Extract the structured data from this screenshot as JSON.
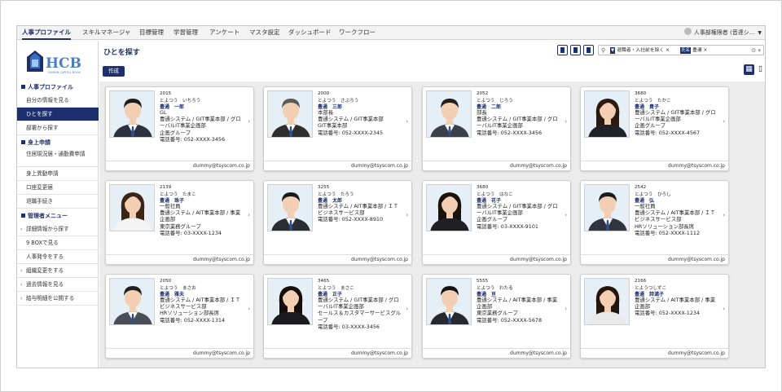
{
  "nav": {
    "items": [
      "人事プロファイル",
      "スキルマネージャ",
      "目標管理",
      "学習管理",
      "アンケート",
      "マスタ設定",
      "ダッシュボード",
      "ワークフロー"
    ],
    "active_index": 0,
    "user_label": "人事部権限者 (音達シ..."
  },
  "sidebar": {
    "logo_text": "HCB",
    "sections": [
      {
        "title": "人事プロファイル",
        "items": [
          "自分の情報を見る",
          "ひとを探す",
          "部署から探す"
        ],
        "active": 1
      },
      {
        "title": "身上申請",
        "items": [
          "住居現況届・通勤費申請",
          "身上異動申請",
          "口座変更届",
          "退職手続き"
        ]
      },
      {
        "title": "管理者メニュー",
        "items": [
          "詳細情報から探す",
          "9 BOXで見る",
          "人事発令をする",
          "組織変更をする",
          "過去情報を見る",
          "給与明細を公開する"
        ]
      }
    ]
  },
  "main": {
    "title": "ひとを探す",
    "create_label": "作成",
    "filter": {
      "tag1": "退職者・入社前を除く",
      "tag1_icon": "▼",
      "tag2": "豊達",
      "tag2_icon": "氏名"
    }
  },
  "colors": {
    "brand": "#1d2f6e",
    "grid_bg": "#ececec"
  },
  "cards": [
    {
      "code": "2015",
      "kana": "とよつう　いちろう",
      "name": "豊通　一郎",
      "lines": [
        "GL",
        "豊通システム / GIT事業本部 / グロ",
        "ーバルIT事業企画部",
        "企画グループ",
        "電話番号: 052-XXXX-3456"
      ],
      "email": "dummy@tsyscom.co.jp",
      "gender": "m",
      "suit": "#2b3140",
      "hair": "#1c1c1c"
    },
    {
      "code": "2000",
      "kana": "とよつう　さぶろう",
      "name": "豊通　三郎",
      "lines": [
        "本部長",
        "豊通システム / GIT事業本部",
        "GIT事業本部",
        "電話番号: 052-XXXX-2345"
      ],
      "email": "dummy@tsyscom.co.jp",
      "gender": "m",
      "suit": "#2e2e2e",
      "hair": "#5a5a5a"
    },
    {
      "code": "2052",
      "kana": "とよつう　じろう",
      "name": "豊通　二郎",
      "lines": [
        "部長",
        "豊通システム / GIT事業本部 / グロ",
        "ーバルIT事業企画部",
        "電話番号: 052-XXXX-3456"
      ],
      "email": "dummy@tsyscom.co.jp",
      "gender": "m",
      "suit": "#3a3f4b",
      "hair": "#202020"
    },
    {
      "code": "3680",
      "kana": "とよつう　たかこ",
      "name": "豊通　貴子",
      "lines": [
        "豊通システム / GIT事業本部 / グロ",
        "ーバルIT事業企画部",
        "企画グループ",
        "電話番号: 052-XXXX-4567"
      ],
      "email": "dummy@tsyscom.co.jp",
      "gender": "f",
      "suit": "#1f2228",
      "hair": "#2a1a12"
    },
    {
      "code": "2139",
      "kana": "とよつう　たまこ",
      "name": "豊通　珠子",
      "lines": [
        "一般社員",
        "豊通システム / AIT事業本部 / 事業",
        "企画部",
        "東京業務グループ",
        "電話番号: 03-XXXX-1234"
      ],
      "email": "dummy@tsyscom.co.jp",
      "gender": "f",
      "suit": "#f4f4f4",
      "hair": "#3a2416"
    },
    {
      "code": "3255",
      "kana": "とよつう　たろう",
      "name": "豊通　太郎",
      "lines": [
        "豊通システム / AIT事業本部 / ＩＴ",
        "ビジネスサービス部",
        "電話番号: 052-XXXX-8910"
      ],
      "email": "dummy@tsyscom.co.jp",
      "gender": "m",
      "suit": "#2a2d33",
      "hair": "#1a1a1a"
    },
    {
      "code": "3680",
      "kana": "とよつう　はなこ",
      "name": "豊通　花子",
      "lines": [
        "豊通システム / GIT事業本部 / グロ",
        "ーバルIT事業企画部",
        "企画グループ",
        "電話番号: 03-XXXX-9101"
      ],
      "email": "dummy@tsyscom.co.jp",
      "gender": "f",
      "suit": "#1f1f24",
      "hair": "#1b120c"
    },
    {
      "code": "2542",
      "kana": "とよつう　ひろし",
      "name": "豊通　弘",
      "lines": [
        "一般社員",
        "豊通システム / AIT事業本部 / ＩＴ",
        "ビジネスサービス部",
        "HRソリューション部長席",
        "電話番号: 052-XXXX-1112"
      ],
      "email": "dummy@tsyscom.co.jp",
      "gender": "m",
      "suit": "#30343c",
      "hair": "#1c1c1c"
    },
    {
      "code": "2050",
      "kana": "とよつう　まさお",
      "name": "豊通　雅夫",
      "lines": [
        "豊通システム / AIT事業本部 / ＩＴ",
        "ビジネスサービス部",
        "HRソリューション部長席",
        "電話番号: 052-XXXX-1314"
      ],
      "email": "dummy@tsyscom.co.jp",
      "gender": "m",
      "suit": "#4a4e57",
      "hair": "#1f1f1f"
    },
    {
      "code": "3465",
      "kana": "とよつう　まさこ",
      "name": "豊通　正子",
      "lines": [
        "豊通システム / GIT事業本部 / グロ",
        "ーバルIT事業企画部",
        "セールス＆カスタマーサービスグル",
        "ープ",
        "電話番号: 03-XXXX-3456"
      ],
      "email": "dummy@tsyscom.co.jp",
      "gender": "f",
      "suit": "#1c1c20",
      "hair": "#150e0a"
    },
    {
      "code": "5555",
      "kana": "とよつう　わたる",
      "name": "豊通　亘",
      "lines": [
        "豊通システム / AIT事業本部 / 事業",
        "企画部",
        "東京業務グループ",
        "電話番号: 052-XXXX-5678"
      ],
      "email": "dummy@tsyscom.co.jp",
      "gender": "m",
      "suit": "#26292f",
      "hair": "#141414"
    },
    {
      "code": "2166",
      "kana": "とようつしずこ",
      "name": "豊通　詩満子",
      "lines": [
        "豊通システム / AIT事業本部 / 事業",
        "企画部",
        "電話番号: 052-XXXX-1234"
      ],
      "email": "dummy@tsyscom.co.jp",
      "gender": "f",
      "suit": "#e9e9e9",
      "hair": "#24160e"
    }
  ]
}
